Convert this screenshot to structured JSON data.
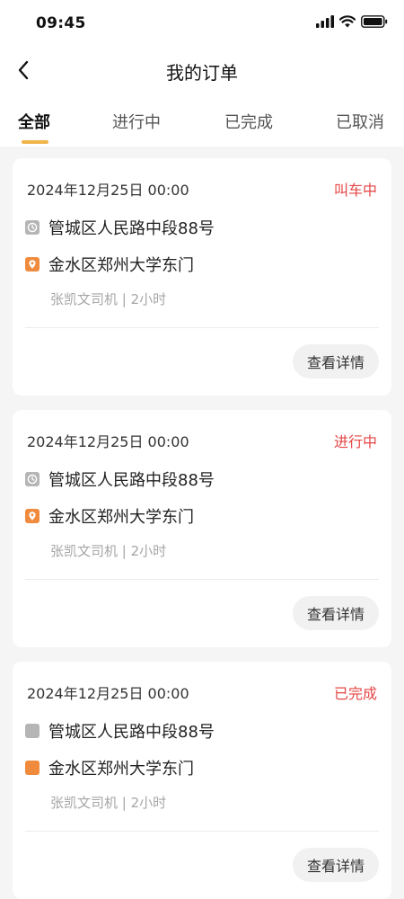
{
  "status_bar": {
    "time": "09:45"
  },
  "nav": {
    "title": "我的订单"
  },
  "tabs": [
    {
      "label": "全部",
      "active": true
    },
    {
      "label": "进行中",
      "active": false
    },
    {
      "label": "已完成",
      "active": false
    },
    {
      "label": "已取消",
      "active": false
    }
  ],
  "colors": {
    "accent": "#f0b44a",
    "status_red": "#e54545",
    "start_icon": "#b5b5b5",
    "end_icon": "#f08a3c"
  },
  "orders": [
    {
      "date": "2024年12月25日  00:00",
      "status": "叫车中",
      "start": "管城区人民路中段88号",
      "end": "金水区郑州大学东门",
      "driver": "张凯文司机 | 2小时",
      "detail_label": "查看详情"
    },
    {
      "date": "2024年12月25日  00:00",
      "status": "进行中",
      "start": "管城区人民路中段88号",
      "end": "金水区郑州大学东门",
      "driver": "张凯文司机 | 2小时",
      "detail_label": "查看详情"
    },
    {
      "date": "2024年12月25日  00:00",
      "status": "已完成",
      "start": "管城区人民路中段88号",
      "end": "金水区郑州大学东门",
      "driver": "张凯文司机 | 2小时",
      "detail_label": "查看详情"
    }
  ]
}
